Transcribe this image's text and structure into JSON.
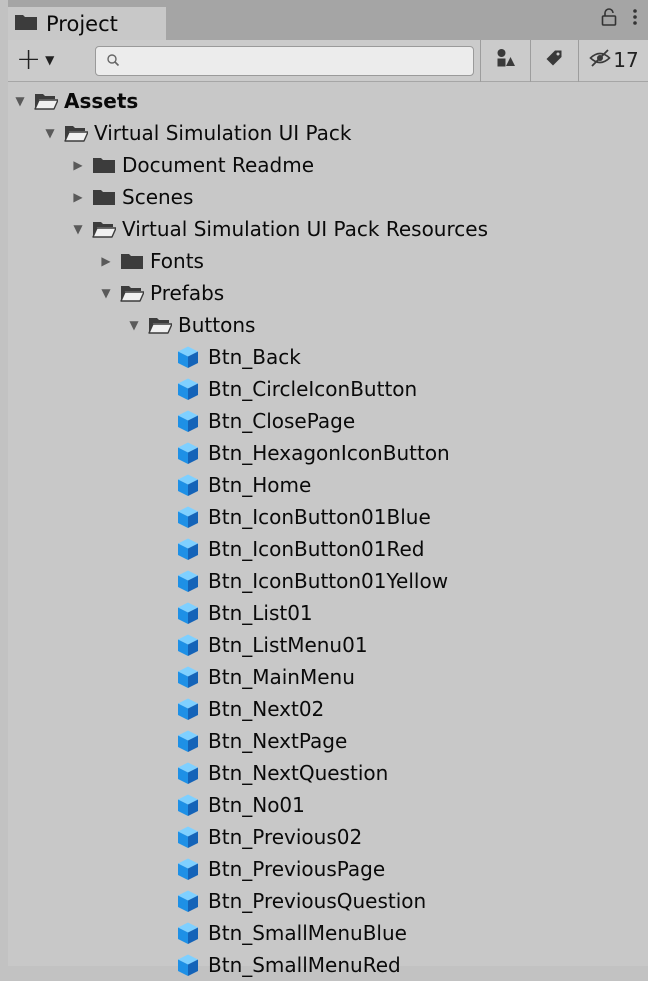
{
  "window": {
    "tab_title": "Project",
    "hidden_count": "17"
  },
  "toolbar": {
    "search_placeholder": "",
    "create_icon": "plus-icon",
    "filter_type_icon": "filter-by-type-icon",
    "filter_label_icon": "label-tag-icon",
    "hidden_icon": "eye-slash-icon"
  },
  "tree": {
    "assets": "Assets",
    "vsui_pack": "Virtual Simulation UI Pack",
    "document_readme": "Document Readme",
    "scenes": "Scenes",
    "vsui_resources": "Virtual Simulation UI Pack Resources",
    "fonts": "Fonts",
    "prefabs": "Prefabs",
    "buttons": "Buttons",
    "button_items": [
      "Btn_Back",
      "Btn_CircleIconButton",
      "Btn_ClosePage",
      "Btn_HexagonIconButton",
      "Btn_Home",
      "Btn_IconButton01Blue",
      "Btn_IconButton01Red",
      "Btn_IconButton01Yellow",
      "Btn_List01",
      "Btn_ListMenu01",
      "Btn_MainMenu",
      "Btn_Next02",
      "Btn_NextPage",
      "Btn_NextQuestion",
      "Btn_No01",
      "Btn_Previous02",
      "Btn_PreviousPage",
      "Btn_PreviousQuestion",
      "Btn_SmallMenuBlue",
      "Btn_SmallMenuRed"
    ]
  },
  "colors": {
    "prefab_blue": "#1e90e6",
    "folder_dark": "#3c3c3c"
  }
}
